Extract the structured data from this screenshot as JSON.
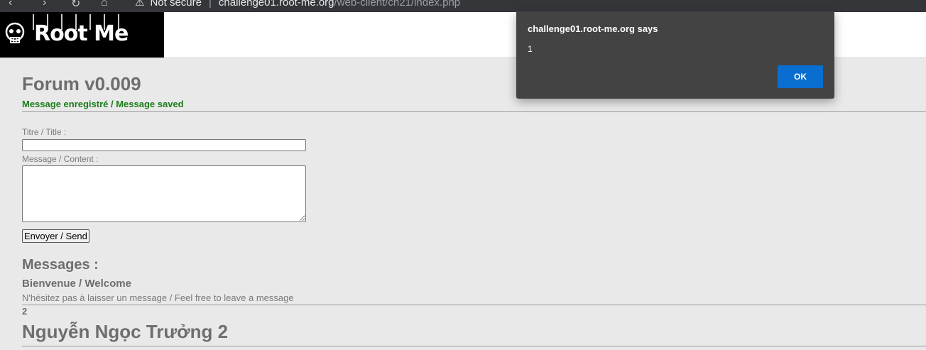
{
  "browser": {
    "security_label": "Not secure",
    "url_host": "challenge01.root-me.org",
    "url_path": "/web-client/ch21/index.php"
  },
  "header": {
    "logo_text": "Root Me"
  },
  "forum": {
    "title": "Forum v0.009",
    "status": "Message enregistré / Message saved",
    "title_label": "Titre / Title :",
    "content_label": "Message / Content :",
    "title_value": "",
    "content_value": "",
    "send_label": "Envoyer / Send",
    "messages_heading": "Messages :",
    "messages": [
      {
        "title": "Bienvenue / Welcome",
        "body": "N'hésitez pas à laisser un message / Feel free to leave a message"
      },
      {
        "title": "Nguyễn Ngọc Trưởng 2",
        "body": "2"
      }
    ]
  },
  "dialog": {
    "title": "challenge01.root-me.org says",
    "message": "1",
    "ok_label": "OK",
    "ok_color": "#0a6ed1"
  },
  "colors": {
    "page_background": "#e9e9e9",
    "status_green": "#1b7d1b",
    "dialog_background": "#434343"
  }
}
